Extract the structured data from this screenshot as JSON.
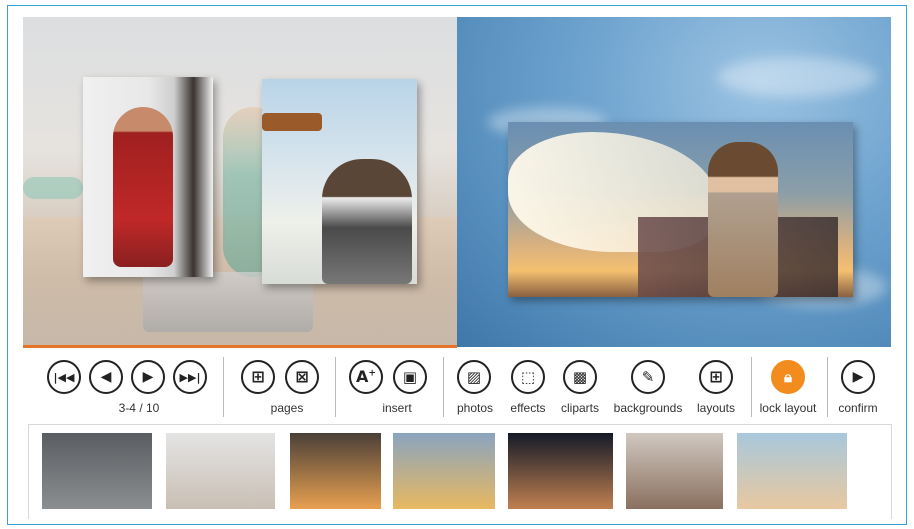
{
  "pager": {
    "label": "3-4 / 10"
  },
  "toolbar": {
    "pages_label": "pages",
    "insert_label": "insert",
    "photos_label": "photos",
    "effects_label": "effects",
    "cliparts_label": "cliparts",
    "backgrounds_label": "backgrounds",
    "layouts_label": "layouts",
    "lock_layout_label": "lock layout",
    "confirm_label": "confirm"
  },
  "icons": {
    "first": "first-page-icon",
    "prev": "previous-page-icon",
    "next": "next-page-icon",
    "last": "last-page-icon",
    "add_page": "add-page-icon",
    "remove_page": "remove-page-icon",
    "insert_text": "insert-text-icon",
    "insert_image": "insert-image-icon",
    "photos": "photos-icon",
    "effects": "effects-icon",
    "cliparts": "cliparts-icon",
    "backgrounds": "paint-brush-icon",
    "layouts": "grid-layout-icon",
    "lock": "lock-icon",
    "confirm": "play-icon"
  },
  "colors": {
    "accent": "#f28c1f",
    "frame_border": "#3aa0d8",
    "page_indicator": "#e8742a"
  },
  "thumbnails": [
    {
      "name": "thumb-1",
      "color_top": "#5a5e62",
      "color_bottom": "#8a8e90"
    },
    {
      "name": "thumb-2",
      "color_top": "#e4e4e4",
      "color_bottom": "#c9bfb4"
    },
    {
      "name": "thumb-3",
      "color_top": "#4a4038",
      "color_bottom": "#e8a050"
    },
    {
      "name": "thumb-4",
      "color_top": "#8aa4c0",
      "color_bottom": "#e8b860"
    },
    {
      "name": "thumb-5",
      "color_top": "#141a28",
      "color_bottom": "#c08050"
    },
    {
      "name": "thumb-6",
      "color_top": "#d0c8c0",
      "color_bottom": "#8a7060"
    },
    {
      "name": "thumb-7",
      "color_top": "#a8c8dc",
      "color_bottom": "#e8c8a0"
    }
  ]
}
